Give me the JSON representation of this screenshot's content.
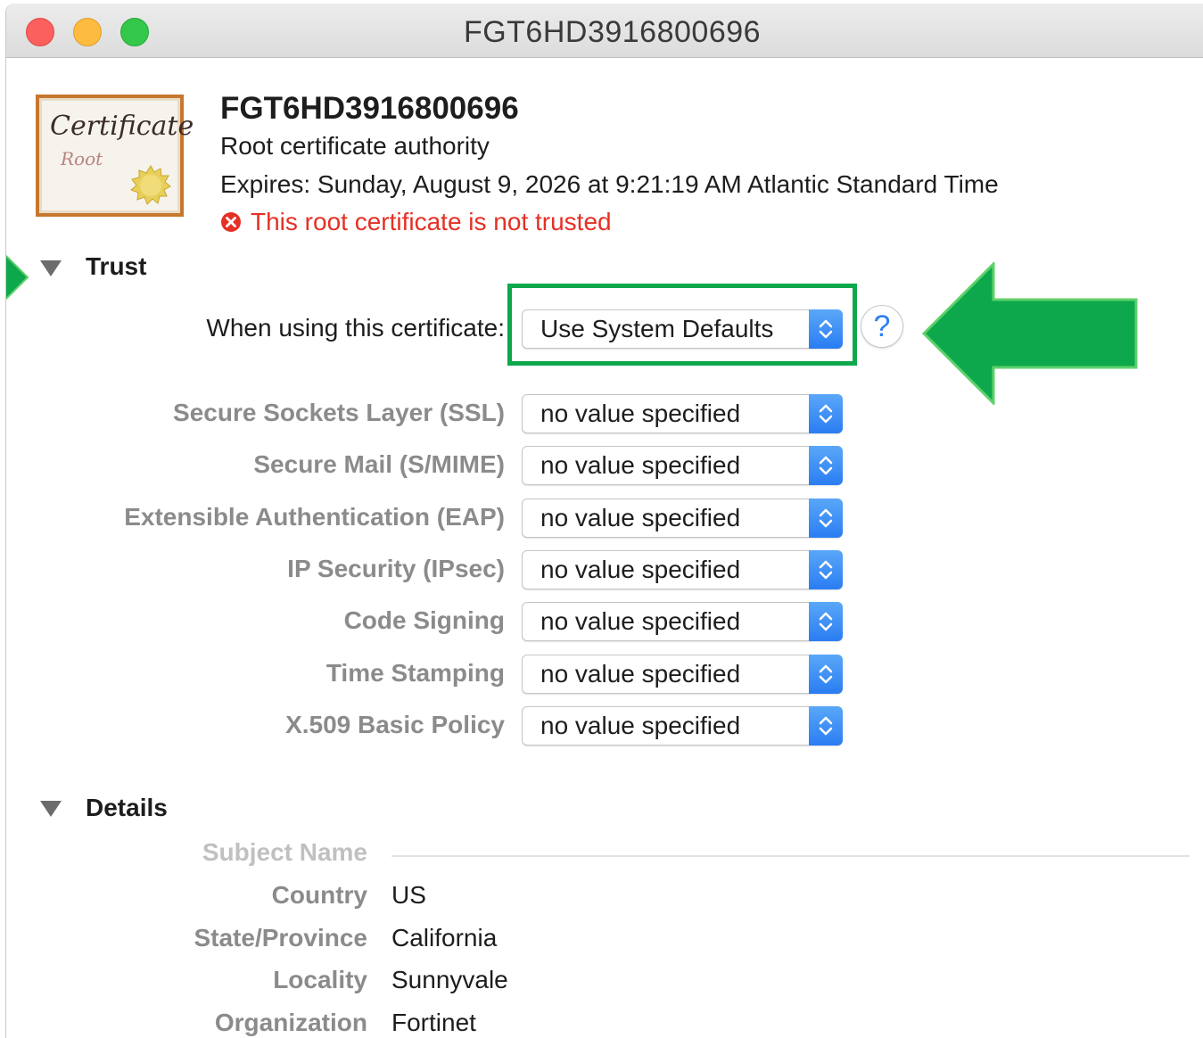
{
  "window": {
    "title": "FGT6HD3916800696"
  },
  "certificate": {
    "icon_word": "Certificate",
    "icon_sub": "Root",
    "name": "FGT6HD3916800696",
    "kind": "Root certificate authority",
    "expires": "Expires: Sunday, August 9, 2026 at 9:21:19 AM Atlantic Standard Time",
    "warning": "This root certificate is not trusted",
    "warning_color": "#e53025"
  },
  "trust": {
    "section_label": "Trust",
    "main": {
      "label": "When using this certificate:",
      "value": "Use System Defaults"
    },
    "help_label": "?",
    "rows": [
      {
        "label": "Secure Sockets Layer (SSL)",
        "value": "no value specified"
      },
      {
        "label": "Secure Mail (S/MIME)",
        "value": "no value specified"
      },
      {
        "label": "Extensible Authentication (EAP)",
        "value": "no value specified"
      },
      {
        "label": "IP Security (IPsec)",
        "value": "no value specified"
      },
      {
        "label": "Code Signing",
        "value": "no value specified"
      },
      {
        "label": "Time Stamping",
        "value": "no value specified"
      },
      {
        "label": "X.509 Basic Policy",
        "value": "no value specified"
      }
    ],
    "highlight_color": "#0ea84c"
  },
  "details": {
    "section_label": "Details",
    "subject_heading": "Subject Name",
    "fields": [
      {
        "key": "Country",
        "value": "US"
      },
      {
        "key": "State/Province",
        "value": "California"
      },
      {
        "key": "Locality",
        "value": "Sunnyvale"
      },
      {
        "key": "Organization",
        "value": "Fortinet"
      }
    ]
  }
}
